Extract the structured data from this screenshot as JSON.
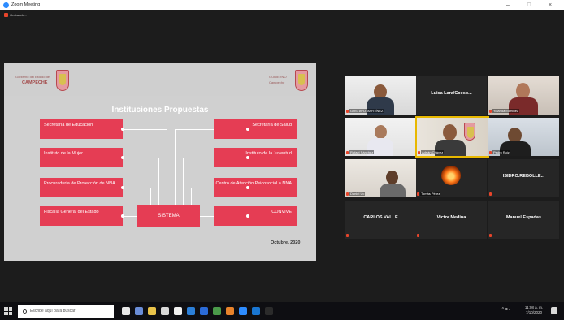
{
  "window": {
    "title": "Zoom Meeting",
    "controls": [
      "–",
      "□",
      "×"
    ],
    "recording_label": "Grabando..."
  },
  "slide": {
    "left_logo_line1": "Gobierno del Estado de",
    "left_logo_line2": "CAMPECHE",
    "right_logo_line1": "GOBIERNO",
    "right_logo_line2": "Campeche",
    "title": "Instituciones Propuestas",
    "left_boxes": [
      "Secretaría de Educación",
      "Instituto de la Mujer",
      "Procuraduría de Protección de NNA",
      "Fiscalía General del Estado"
    ],
    "right_boxes": [
      "Secretaría de Salud",
      "Instituto de la Juventud",
      "Centro de Atención Psicosocial a NNA",
      "CONVIVE"
    ],
    "center_box": "SISTEMA",
    "date": "Octubre, 2020"
  },
  "participants": [
    {
      "name": "GUSTAVO MARTÍNEZ",
      "type": "video"
    },
    {
      "name": "Luisa Lara/Coesp...",
      "type": "name"
    },
    {
      "name": "Yolanda Martínez",
      "type": "video"
    },
    {
      "name": "Rafael Sánchez",
      "type": "video"
    },
    {
      "name": "Adrián Chávez",
      "type": "video"
    },
    {
      "name": "Pedro Ruiz",
      "type": "video"
    },
    {
      "name": "Daniel Uc",
      "type": "video"
    },
    {
      "name": "Tomás Pérez",
      "type": "icon"
    },
    {
      "name": "ISIDRO.REBOLLE...",
      "type": "name"
    },
    {
      "name": "CARLOS.VALLE",
      "type": "name"
    },
    {
      "name": "Victor.Medina",
      "type": "name"
    },
    {
      "name": "Manuel Espadas",
      "type": "name"
    }
  ],
  "taskbar": {
    "search_placeholder": "Escribe aquí para buscar",
    "time": "11:08 a. m.",
    "date": "7/10/2020",
    "icon_colors": [
      "#e8e8e8",
      "#6a8dd8",
      "#e8c24a",
      "#d9d9d9",
      "#f0f0f0",
      "#2b7fd8",
      "#2b6bd8",
      "#4a9a4a",
      "#e8832b",
      "#2d8cff",
      "#1976d2",
      "#2b2b2b"
    ]
  },
  "colors": {
    "slide_box": "#e53d54",
    "active_speaker": "#e8b800",
    "zoom_blue": "#2d8cff"
  }
}
